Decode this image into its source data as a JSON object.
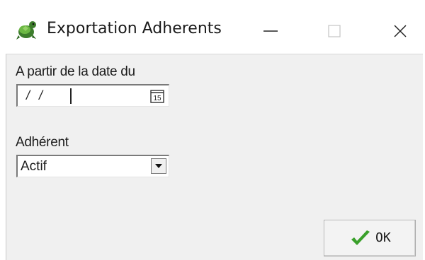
{
  "window": {
    "title": "Exportation Adherents",
    "icon": "turtle-app-icon",
    "controls": [
      "minimize-icon",
      "maximize-icon",
      "close-icon"
    ]
  },
  "form": {
    "date_label": "A partir de la date du",
    "date_value": "/ /",
    "calendar_icon_text": "15",
    "adherent_label": "Adhérent",
    "adherent_selected": "Actif"
  },
  "buttons": {
    "ok_label": "OK"
  },
  "colors": {
    "client_background": "#f0f0f0",
    "check_green": "#3aa02b"
  }
}
